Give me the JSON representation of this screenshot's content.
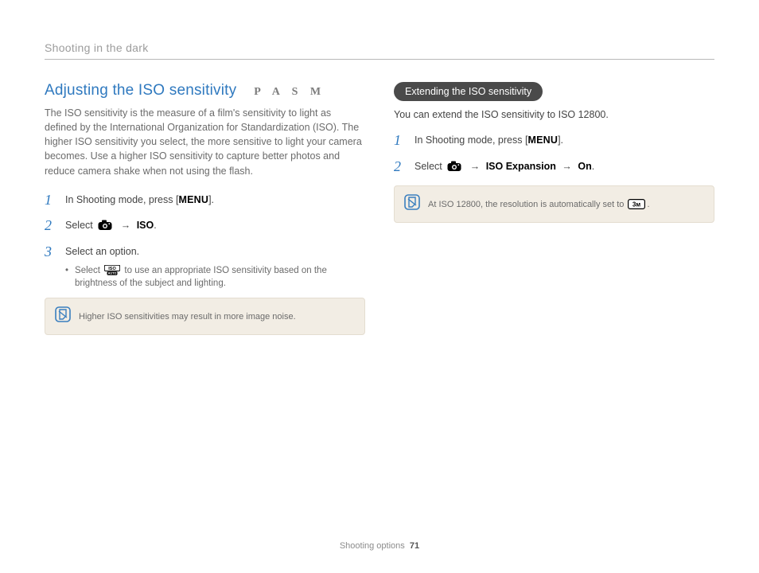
{
  "header": {
    "breadcrumb": "Shooting in the dark"
  },
  "left": {
    "title": "Adjusting the ISO sensitivity",
    "modes": "P A S M",
    "intro": "The ISO sensitivity is the measure of a film's sensitivity to light as defined by the International Organization for Standardization (ISO). The higher ISO sensitivity you select, the more sensitive to light your camera becomes. Use a higher ISO sensitivity to capture better photos and reduce camera shake when not using the flash.",
    "steps": {
      "s1_num": "1",
      "s1_pre": "In Shooting mode, press [",
      "s1_menu": "MENU",
      "s1_post": "].",
      "s2_num": "2",
      "s2_pre": "Select ",
      "s2_arrow": "→",
      "s2_iso": "ISO",
      "s2_post": ".",
      "s3_num": "3",
      "s3_text": "Select an option.",
      "s3_bullet_pre": "Select ",
      "s3_bullet_post": " to use an appropriate ISO sensitivity based on the brightness of the subject and lighting."
    },
    "note": "Higher ISO sensitivities may result in more image noise."
  },
  "right": {
    "pill": "Extending the ISO sensitivity",
    "intro": "You can extend the ISO sensitivity to ISO 12800.",
    "steps": {
      "s1_num": "1",
      "s1_pre": "In Shooting mode, press [",
      "s1_menu": "MENU",
      "s1_post": "].",
      "s2_num": "2",
      "s2_pre": "Select ",
      "s2_arrow1": "→",
      "s2_isoexp": "ISO Expansion",
      "s2_arrow2": "→",
      "s2_on": "On",
      "s2_post": "."
    },
    "note_pre": "At ISO 12800, the resolution is automatically set to ",
    "note_post": "."
  },
  "footer": {
    "section": "Shooting options",
    "page": "71"
  }
}
